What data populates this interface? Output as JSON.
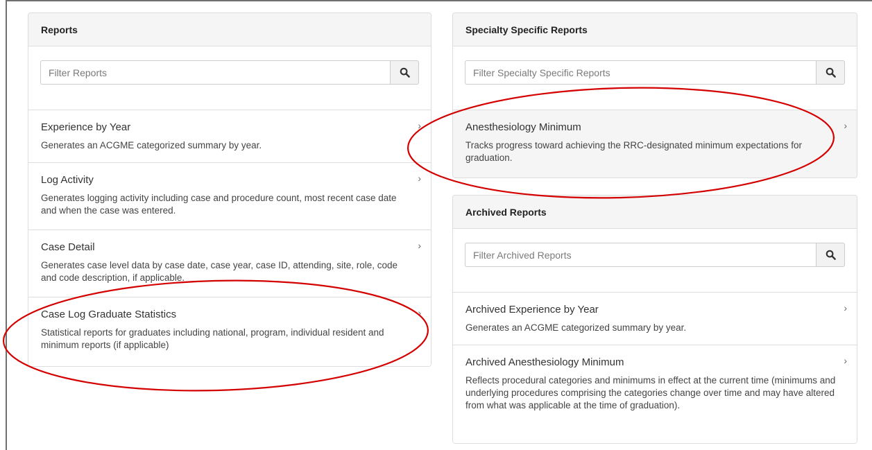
{
  "reports": {
    "heading": "Reports",
    "filter_placeholder": "Filter Reports",
    "items": [
      {
        "title": "Experience by Year",
        "desc": "Generates an ACGME categorized summary by year."
      },
      {
        "title": "Log Activity",
        "desc": "Generates logging activity including case and procedure count, most recent case date and when the case was entered."
      },
      {
        "title": "Case Detail",
        "desc": "Generates case level data by case date, case year, case ID, attending, site, role, code and code description, if applicable."
      },
      {
        "title": "Case Log Graduate Statistics",
        "desc": "Statistical reports for graduates including national, program, individual resident and minimum reports (if applicable)"
      }
    ]
  },
  "specialty": {
    "heading": "Specialty Specific Reports",
    "filter_placeholder": "Filter Specialty Specific Reports",
    "items": [
      {
        "title": "Anesthesiology Minimum",
        "desc": "Tracks progress toward achieving the RRC-designated minimum expectations for graduation."
      }
    ]
  },
  "archived": {
    "heading": "Archived Reports",
    "filter_placeholder": "Filter Archived Reports",
    "items": [
      {
        "title": "Archived Experience by Year",
        "desc": "Generates an ACGME categorized summary by year."
      },
      {
        "title": "Archived Anesthesiology Minimum",
        "desc": "Reflects procedural categories and minimums in effect at the current time (minimums and underlying procedures comprising the categories change over time and may have altered from what was applicable at the time of graduation)."
      }
    ]
  },
  "icons": {
    "search": "search-icon",
    "chevron": "chevron-right-icon"
  },
  "chevron_glyph": "›",
  "colors": {
    "annotation": "#d40000",
    "panel_border": "#dddddd",
    "heading_bg": "#f5f5f5"
  }
}
